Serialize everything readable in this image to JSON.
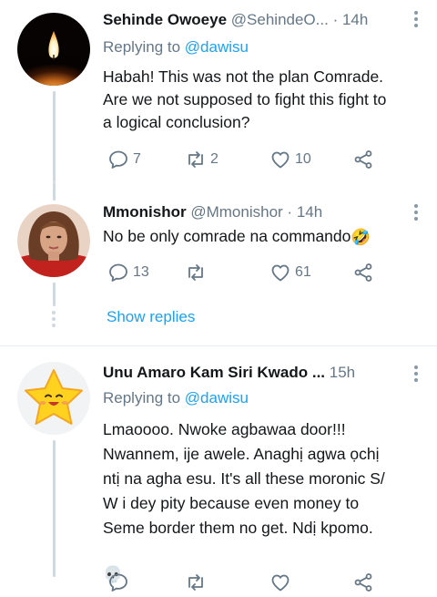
{
  "tweets": [
    {
      "name": "Sehinde Owoeye",
      "handle": "@SehindeO...",
      "dot": "·",
      "time": "14h",
      "replying_prefix": "Replying to ",
      "replying_to": "@dawisu",
      "text": "Habah! This was not the plan Comrade.\nAre we not supposed to fight this fight to\na logical conclusion?",
      "counts": {
        "replies": "7",
        "retweets": "2",
        "likes": "10"
      },
      "avatar_icon": "candle-flame-icon"
    },
    {
      "name": "Mmonishor",
      "handle": "@Mmonishor",
      "dot": "·",
      "time": "14h",
      "text": "No be only comrade na commando",
      "emoji": "🤣",
      "counts": {
        "replies": "13",
        "retweets": "",
        "likes": "61"
      },
      "avatar_icon": "profile-photo-woman"
    },
    {
      "name": "Unu Amaro Kam Siri Kwado ...",
      "handle": "",
      "dot": "",
      "time": "15h",
      "replying_prefix": "Replying to ",
      "replying_to": "@dawisu",
      "text": "Lmaoooo. Nwoke agbawaa door!!!\nNwannem, ije awele. Anaghị agwa ọchị\nntị na agha esu. It's all these moronic S/\nW i dey pity because even money to\nSeme border them no get. Ndị kpomo.",
      "emoji": "💀",
      "avatar_icon": "smiling-star-icon"
    }
  ],
  "show_replies": "Show replies",
  "colors": {
    "link": "#1da1f2",
    "secondary": "#657786",
    "thread": "#cfd9de"
  }
}
